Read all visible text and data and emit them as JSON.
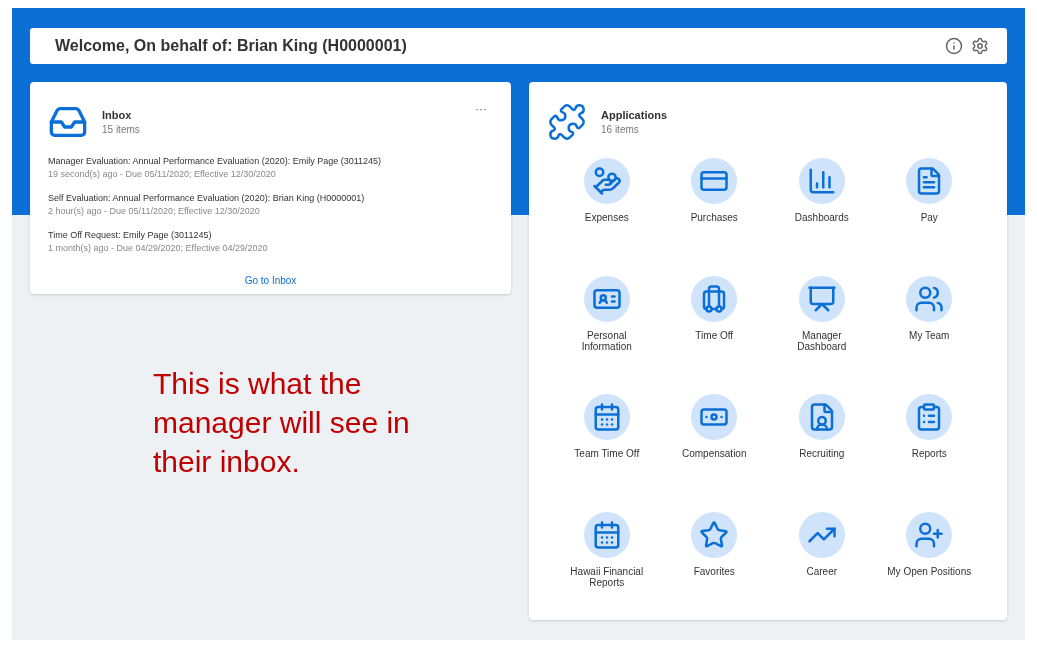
{
  "welcome": {
    "title": "Welcome, On behalf of: Brian King (H0000001)"
  },
  "inbox": {
    "title": "Inbox",
    "count": "15 items",
    "more": "···",
    "link": "Go to Inbox",
    "items": [
      {
        "title": "Manager Evaluation: Annual Performance Evaluation (2020): Emily Page (3011245)",
        "meta": "19 second(s) ago - Due 05/11/2020; Effective 12/30/2020"
      },
      {
        "title": "Self Evaluation: Annual Performance Evaluation (2020): Brian King (H0000001)",
        "meta": "2 hour(s) ago - Due 05/11/2020; Effective 12/30/2020"
      },
      {
        "title": "Time Off Request: Emily Page (3011245)",
        "meta": "1 month(s) ago - Due 04/29/2020; Effective 04/29/2020"
      }
    ]
  },
  "applications": {
    "title": "Applications",
    "count": "16 items",
    "apps": [
      {
        "label": "Expenses",
        "kind": "hand"
      },
      {
        "label": "Purchases",
        "kind": "card"
      },
      {
        "label": "Dashboards",
        "kind": "chart"
      },
      {
        "label": "Pay",
        "kind": "doc"
      },
      {
        "label": "Personal Information",
        "kind": "id"
      },
      {
        "label": "Time Off",
        "kind": "luggage"
      },
      {
        "label": "Manager Dashboard",
        "kind": "board"
      },
      {
        "label": "My Team",
        "kind": "team"
      },
      {
        "label": "Team Time Off",
        "kind": "calendar"
      },
      {
        "label": "Compensation",
        "kind": "money"
      },
      {
        "label": "Recruiting",
        "kind": "resume"
      },
      {
        "label": "Reports",
        "kind": "clipboard"
      },
      {
        "label": "Hawaii Financial Reports",
        "kind": "calendar"
      },
      {
        "label": "Favorites",
        "kind": "star"
      },
      {
        "label": "Career",
        "kind": "career"
      },
      {
        "label": "My Open Positions",
        "kind": "positions"
      }
    ]
  },
  "note": {
    "text": "This is what the manager will see in their inbox."
  }
}
